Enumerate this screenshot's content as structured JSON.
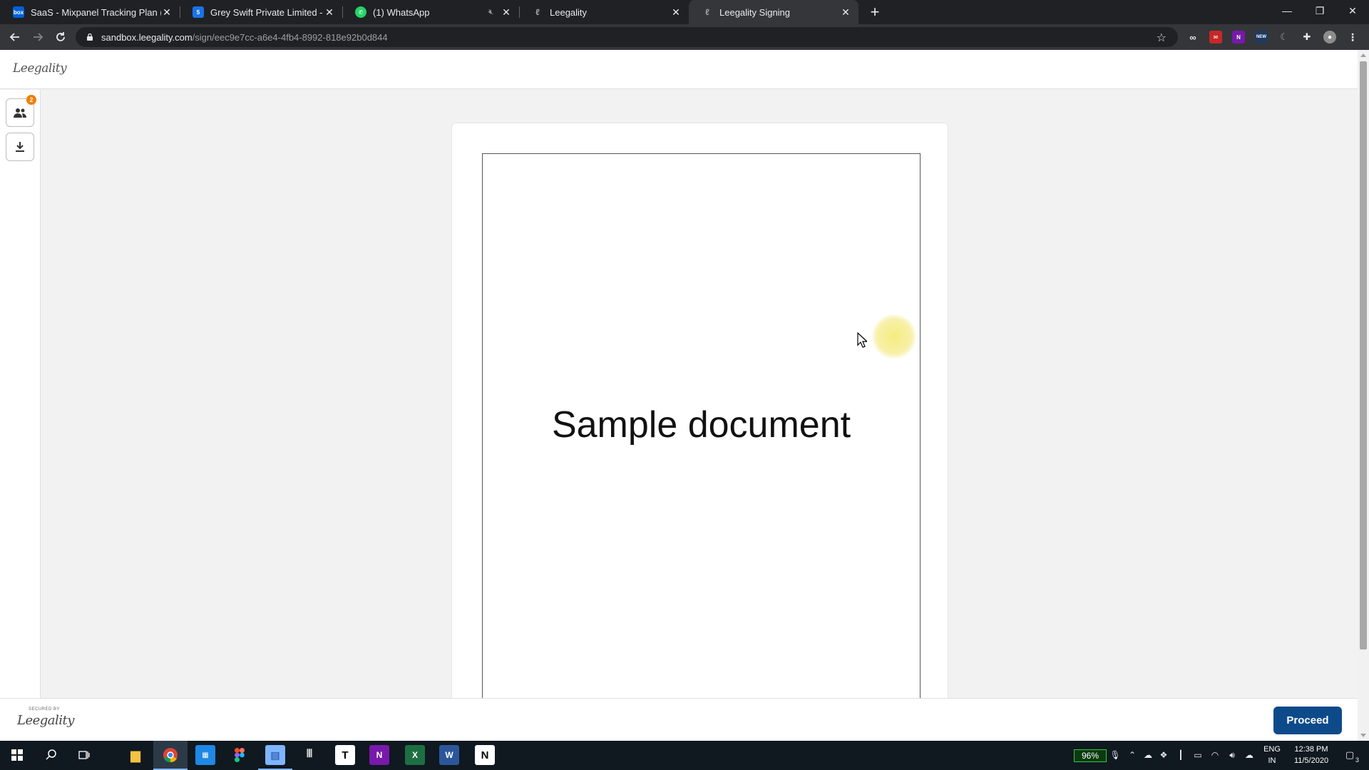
{
  "browser": {
    "tabs": [
      {
        "title": "SaaS - Mixpanel Tracking Plan (1",
        "favicon": "box-logo",
        "favicon_color": "#0061d5"
      },
      {
        "title": "Grey Swift Private Limited - Caler",
        "favicon": "calendar-logo",
        "favicon_color": "#1a73e8"
      },
      {
        "title": "(1) WhatsApp",
        "favicon": "whatsapp-logo",
        "favicon_color": "#25d366"
      },
      {
        "title": "Leegality",
        "favicon": "leegality-logo",
        "favicon_color": "#5f6368"
      },
      {
        "title": "Leegality Signing",
        "favicon": "leegality-logo",
        "favicon_color": "#5f6368",
        "active": true
      }
    ],
    "url_host": "sandbox.leegality.com",
    "url_path": "/sign/eec9e7cc-a6e4-4fb4-8992-818e92b0d844"
  },
  "app": {
    "logo_text": "Leegality",
    "signers_badge": "2",
    "document_text": "Sample document",
    "footer_secured": "SECURED BY",
    "footer_logo_text": "Leegality",
    "proceed_label": "Proceed",
    "accent_color": "#0d4a8a"
  },
  "taskbar": {
    "battery": "96%",
    "lang_top": "ENG",
    "lang_bottom": "IN",
    "time": "12:38 PM",
    "date": "11/5/2020",
    "notifications": "3"
  }
}
